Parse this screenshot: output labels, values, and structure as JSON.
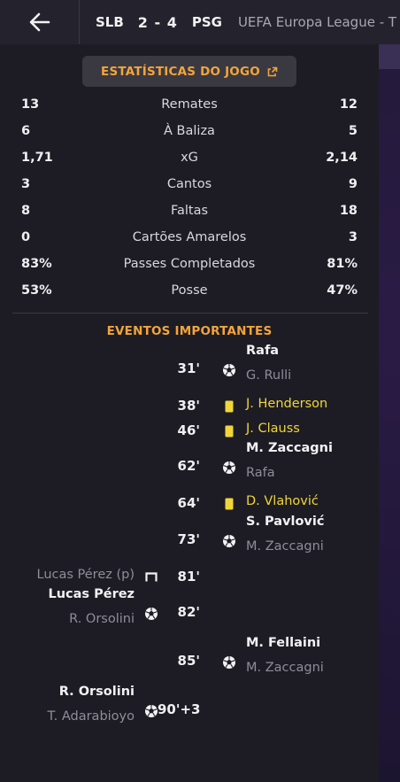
{
  "header": {
    "back_icon": "arrow-left-icon",
    "home_team": "SLB",
    "score": "2 - 4",
    "away_team": "PSG",
    "competition": "UEFA Europa League  -  T"
  },
  "stats_title": "ESTATÍSTICAS DO JOGO",
  "stats": [
    {
      "label": "Remates",
      "home": "13",
      "away": "12"
    },
    {
      "label": "À Baliza",
      "home": "6",
      "away": "5"
    },
    {
      "label": "xG",
      "home": "1,71",
      "away": "2,14"
    },
    {
      "label": "Cantos",
      "home": "3",
      "away": "9"
    },
    {
      "label": "Faltas",
      "home": "8",
      "away": "18"
    },
    {
      "label": "Cartões Amarelos",
      "home": "0",
      "away": "3"
    },
    {
      "label": "Passes Completados",
      "home": "83%",
      "away": "81%"
    },
    {
      "label": "Posse",
      "home": "53%",
      "away": "47%"
    }
  ],
  "events_title": "EVENTOS IMPORTANTES",
  "events": [
    {
      "minute": "31'",
      "side": "away",
      "type": "goal",
      "player": "Rafa",
      "detail": "G. Rulli"
    },
    {
      "minute": "38'",
      "side": "away",
      "type": "yellow",
      "player": "J. Henderson",
      "detail": ""
    },
    {
      "minute": "46'",
      "side": "away",
      "type": "yellow",
      "player": "J. Clauss",
      "detail": ""
    },
    {
      "minute": "62'",
      "side": "away",
      "type": "goal",
      "player": "M. Zaccagni",
      "detail": "Rafa"
    },
    {
      "minute": "64'",
      "side": "away",
      "type": "yellow",
      "player": "D. Vlahović",
      "detail": ""
    },
    {
      "minute": "73'",
      "side": "away",
      "type": "goal",
      "player": "S. Pavlović",
      "detail": "M. Zaccagni"
    },
    {
      "minute": "81'",
      "side": "home",
      "type": "penalty-miss",
      "player": "",
      "detail": "Lucas Pérez (p)"
    },
    {
      "minute": "82'",
      "side": "home",
      "type": "goal",
      "player": "Lucas Pérez",
      "detail": "R. Orsolini"
    },
    {
      "minute": "85'",
      "side": "away",
      "type": "goal",
      "player": "M. Fellaini",
      "detail": "M. Zaccagni"
    },
    {
      "minute": "90'+3",
      "side": "home",
      "type": "goal",
      "player": "R. Orsolini",
      "detail": "T. Adarabioyo"
    }
  ],
  "colors": {
    "accent": "#f4a43a",
    "yellow_card": "#f1d63a",
    "muted": "#8e8d98"
  }
}
